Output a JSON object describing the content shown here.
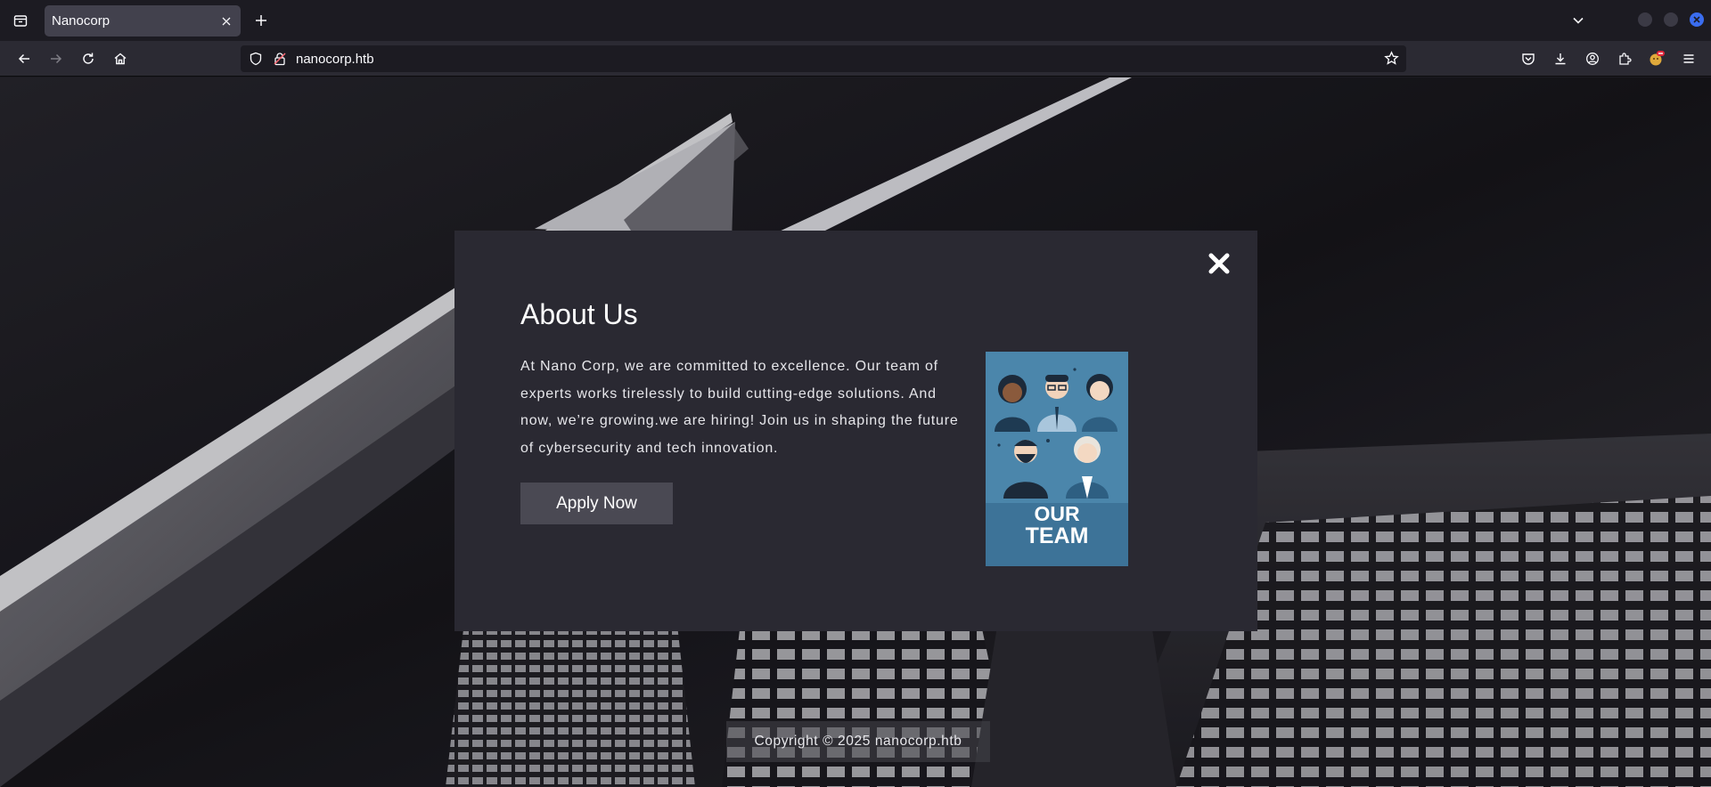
{
  "browser": {
    "tab_title": "Nanocorp",
    "url": "nanocorp.htb"
  },
  "modal": {
    "title": "About Us",
    "body": "At Nano Corp, we are committed to excellence. Our team of experts works tirelessly to build cutting-edge solutions. And now, we’re growing.we are hiring! Join us in shaping the future of cybersecurity and tech innovation.",
    "apply_label": "Apply Now",
    "team_image": {
      "line1": "OUR",
      "line2": "TEAM"
    }
  },
  "footer": {
    "copyright": "Copyright © 2025 nanocorp.htb"
  },
  "colors": {
    "accent": "#3a6df0",
    "modal_bg": "#2a2932",
    "button_bg": "#4a4953"
  }
}
